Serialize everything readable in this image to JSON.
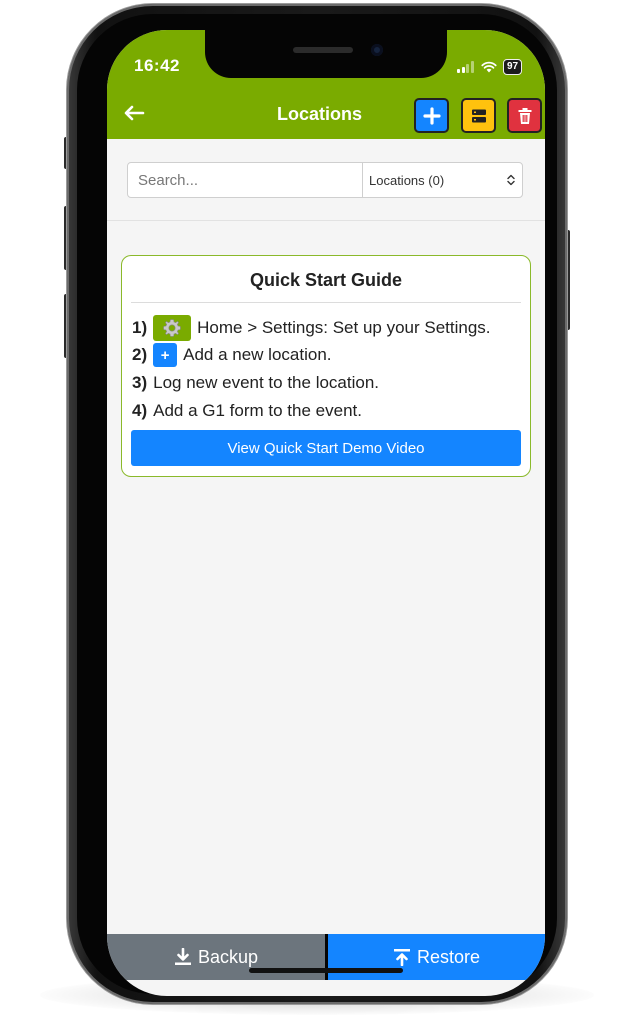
{
  "status_bar": {
    "time": "16:42",
    "battery": "97"
  },
  "header": {
    "title": "Locations",
    "color": "#7aab00",
    "buttons": {
      "add_color": "#1485ff",
      "save_color": "#ffc20e",
      "delete_color": "#e0323f"
    }
  },
  "search": {
    "placeholder": "Search...",
    "select_value": "Locations (0)"
  },
  "guide": {
    "title": "Quick Start Guide",
    "steps": [
      {
        "num": "1)",
        "icon": "gear-icon",
        "text": "Home > Settings: Set up your Settings."
      },
      {
        "num": "2)",
        "icon": "plus-icon",
        "text": "Add a new location."
      },
      {
        "num": "3)",
        "text": "Log new event to the location."
      },
      {
        "num": "4)",
        "text": "Add a G1 form to the event."
      }
    ],
    "plus_glyph": "+",
    "demo_button": "View Quick Start Demo Video"
  },
  "footer": {
    "backup_label": "Backup",
    "restore_label": "Restore"
  }
}
